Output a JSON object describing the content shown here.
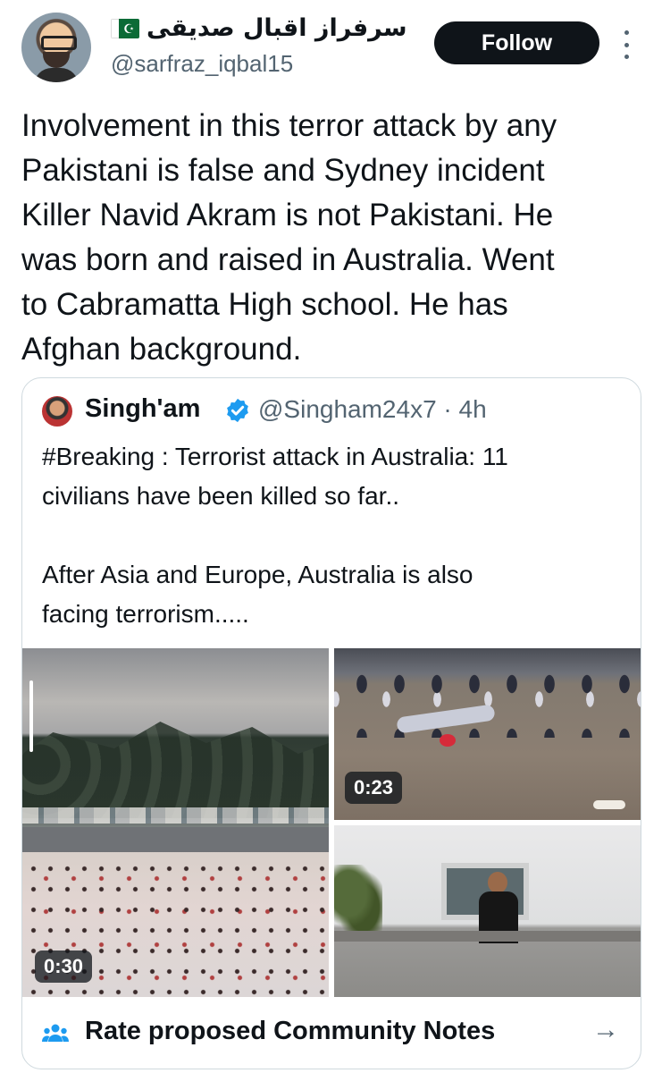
{
  "author": {
    "display_name": "سرفراز اقبال صدیقی",
    "handle": "@sarfraz_iqbal15",
    "flag_icon": "pakistan-flag-icon"
  },
  "actions": {
    "follow_label": "Follow",
    "more_icon": "more-vertical-icon"
  },
  "tweet": {
    "text": "Involvement in this terror attack by any\nPakistani is false and Sydney incident\nKiller Navid Akram is not Pakistani. He\nwas born and raised in Australia. Went\nto Cabramatta High school. He has\nAfghan background."
  },
  "quoted": {
    "name": "Singh'am",
    "verified_icon": "verified-badge-icon",
    "meta": "@Singham24x7 · 4h",
    "text": "#Breaking : Terrorist attack in Australia: 11\ncivilians have been killed so far..\n\nAfter Asia and Europe, Australia is also\nfacing terrorism.....",
    "media": [
      {
        "duration": "0:30"
      },
      {
        "duration": "0:23"
      }
    ]
  },
  "community_notes": {
    "label": "Rate proposed Community Notes",
    "icon": "people-icon",
    "arrow_icon": "arrow-right-icon"
  },
  "colors": {
    "text": "#0f1419",
    "secondary": "#536471",
    "verified": "#1d9bf0",
    "border": "#cfd9de"
  }
}
